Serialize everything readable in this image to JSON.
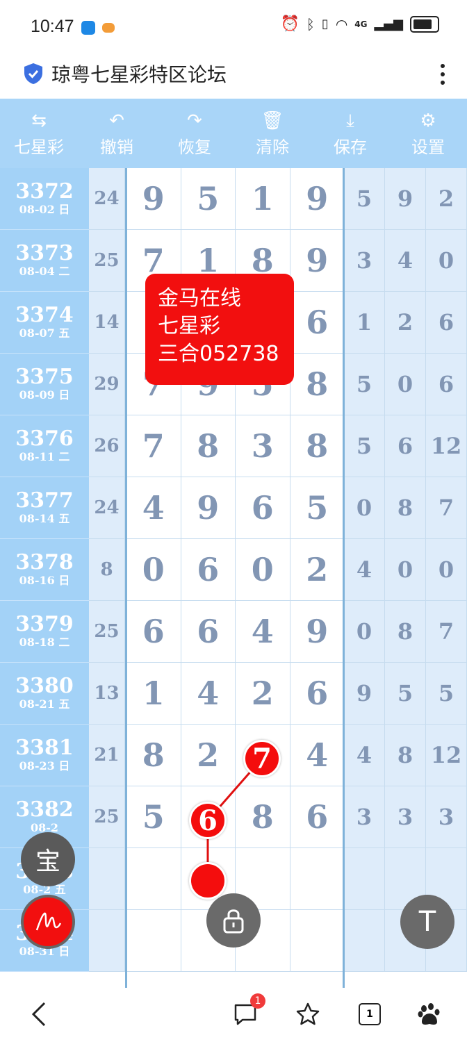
{
  "status_bar": {
    "time": "10:47",
    "network": "4G"
  },
  "header": {
    "title": "琼粤七星彩特区论坛",
    "icons": [
      "shield-icon",
      "more-vertical-icon"
    ]
  },
  "toolbar": {
    "items": [
      {
        "label": "七星彩",
        "icon": "swap-icon"
      },
      {
        "label": "撤销",
        "icon": "undo-icon"
      },
      {
        "label": "恢复",
        "icon": "redo-icon"
      },
      {
        "label": "清除",
        "icon": "trash-icon"
      },
      {
        "label": "保存",
        "icon": "download-icon"
      },
      {
        "label": "设置",
        "icon": "gear-icon"
      }
    ]
  },
  "rows": [
    {
      "issue": "3372",
      "date": "08-02 日",
      "sum": "24",
      "main": [
        "9",
        "5",
        "1",
        "9"
      ],
      "side": [
        "5",
        "9",
        "2"
      ]
    },
    {
      "issue": "3373",
      "date": "08-04 二",
      "sum": "25",
      "main": [
        "7",
        "1",
        "8",
        "9"
      ],
      "side": [
        "3",
        "4",
        "0"
      ]
    },
    {
      "issue": "3374",
      "date": "08-07 五",
      "sum": "14",
      "main": [
        "",
        "",
        "",
        "6"
      ],
      "side": [
        "1",
        "2",
        "6"
      ]
    },
    {
      "issue": "3375",
      "date": "08-09 日",
      "sum": "29",
      "main": [
        "7",
        "9",
        "5",
        "8"
      ],
      "side": [
        "5",
        "0",
        "6"
      ]
    },
    {
      "issue": "3376",
      "date": "08-11 二",
      "sum": "26",
      "main": [
        "7",
        "8",
        "3",
        "8"
      ],
      "side": [
        "5",
        "6",
        "12"
      ]
    },
    {
      "issue": "3377",
      "date": "08-14 五",
      "sum": "24",
      "main": [
        "4",
        "9",
        "6",
        "5"
      ],
      "side": [
        "0",
        "8",
        "7"
      ]
    },
    {
      "issue": "3378",
      "date": "08-16 日",
      "sum": "8",
      "main": [
        "0",
        "6",
        "0",
        "2"
      ],
      "side": [
        "4",
        "0",
        "0"
      ]
    },
    {
      "issue": "3379",
      "date": "08-18 二",
      "sum": "25",
      "main": [
        "6",
        "6",
        "4",
        "9"
      ],
      "side": [
        "0",
        "8",
        "7"
      ]
    },
    {
      "issue": "3380",
      "date": "08-21 五",
      "sum": "13",
      "main": [
        "1",
        "4",
        "2",
        "6"
      ],
      "side": [
        "9",
        "5",
        "5"
      ]
    },
    {
      "issue": "3381",
      "date": "08-23 日",
      "sum": "21",
      "main": [
        "8",
        "2",
        "",
        "4"
      ],
      "side": [
        "4",
        "8",
        "12"
      ]
    },
    {
      "issue": "3382",
      "date": "08-2",
      "sum": "25",
      "main": [
        "5",
        "",
        "8",
        "6"
      ],
      "side": [
        "3",
        "3",
        "3"
      ]
    },
    {
      "issue": "3383",
      "date": "08-2 五",
      "sum": "",
      "main": [
        "",
        "",
        "",
        ""
      ],
      "side": [
        "",
        "",
        ""
      ]
    },
    {
      "issue": "3384",
      "date": "08-31 日",
      "sum": "",
      "main": [
        "",
        "",
        "",
        ""
      ],
      "side": [
        "",
        "",
        ""
      ]
    }
  ],
  "popup": {
    "lines": [
      "金马在线",
      "七星彩",
      "三合052738"
    ]
  },
  "marked_balls": [
    {
      "value": "7"
    },
    {
      "value": "6"
    },
    {
      "value": ""
    }
  ],
  "floating": {
    "bao_label": "宝",
    "t_label": "T"
  },
  "bottom_nav": {
    "message_badge": "1",
    "tab_count": "1"
  },
  "colors": {
    "toolbar_bg": "#a9d5f8",
    "issue_bg": "#a3d2f7",
    "side_bg": "#deecfa",
    "digit": "#8296b4",
    "accent_red": "#f20f0f"
  }
}
